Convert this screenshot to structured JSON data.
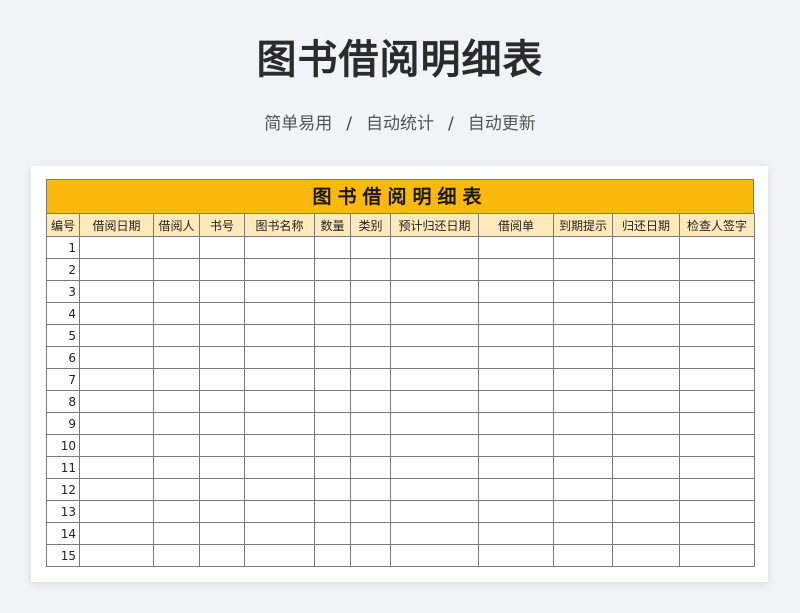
{
  "page": {
    "title": "图书借阅明细表",
    "subtitle": [
      "简单易用",
      "自动统计",
      "自动更新"
    ],
    "subtitle_separator": "/"
  },
  "sheet": {
    "header": "图书借阅明细表",
    "header_color": "#fbb90c",
    "column_header_color": "#fde9ba",
    "columns": [
      "编号",
      "借阅日期",
      "借阅人",
      "书号",
      "图书名称",
      "数量",
      "类别",
      "预计归还日期",
      "借阅单",
      "到期提示",
      "归还日期",
      "检查人签字"
    ],
    "rows": [
      "1",
      "2",
      "3",
      "4",
      "5",
      "6",
      "7",
      "8",
      "9",
      "10",
      "11",
      "12",
      "13",
      "14",
      "15"
    ]
  }
}
